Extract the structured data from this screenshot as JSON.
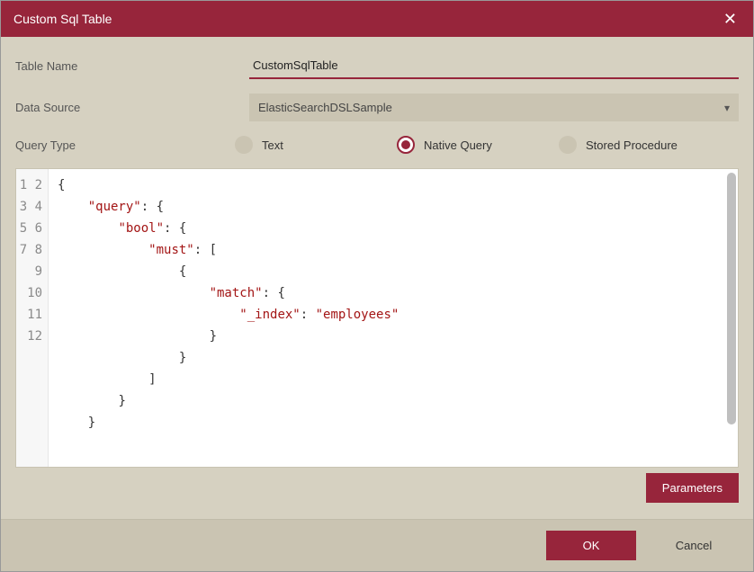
{
  "titlebar": {
    "title": "Custom Sql Table",
    "close": "✕"
  },
  "form": {
    "tableName": {
      "label": "Table Name",
      "value": "CustomSqlTable"
    },
    "dataSource": {
      "label": "Data Source",
      "value": "ElasticSearchDSLSample"
    },
    "queryType": {
      "label": "Query Type",
      "options": [
        {
          "label": "Text",
          "selected": false
        },
        {
          "label": "Native Query",
          "selected": true
        },
        {
          "label": "Stored Procedure",
          "selected": false
        }
      ]
    }
  },
  "editor": {
    "lineNumbers": [
      "1",
      "2",
      "3",
      "4",
      "5",
      "6",
      "7",
      "8",
      "9",
      "10",
      "11",
      "12"
    ],
    "code": {
      "l1": "{",
      "l2_key": "\"query\"",
      "l2_rest": ": {",
      "l3_key": "\"bool\"",
      "l3_rest": ": {",
      "l4_key": "\"must\"",
      "l4_rest": ": [",
      "l5": "{",
      "l6_key": "\"match\"",
      "l6_rest": ": {",
      "l7_key": "\"_index\"",
      "l7_mid": ": ",
      "l7_val": "\"employees\"",
      "l8": "}",
      "l9": "}",
      "l10": "]",
      "l11": "}",
      "l12": "}"
    }
  },
  "buttons": {
    "parameters": "Parameters",
    "ok": "OK",
    "cancel": "Cancel"
  },
  "colors": {
    "accent": "#97253b",
    "panel": "#d6d1c1",
    "panelDark": "#cac4b2"
  }
}
